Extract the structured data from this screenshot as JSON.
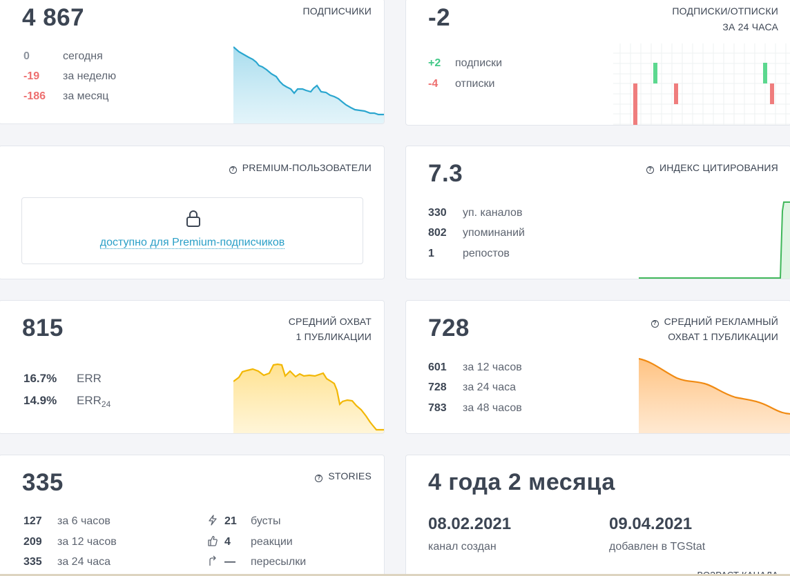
{
  "subscribers": {
    "value": "4 867",
    "label": "ПОДПИСЧИКИ",
    "stats": [
      {
        "value": "0",
        "text": "сегодня"
      },
      {
        "value": "-19",
        "text": "за неделю"
      },
      {
        "value": "-186",
        "text": "за месяц"
      }
    ],
    "color": "#2aa6cf"
  },
  "subs_unsubs": {
    "value": "-2",
    "label_line1": "ПОДПИСКИ/ОТПИСКИ",
    "label_line2": "ЗА 24 ЧАСА",
    "stats": [
      {
        "value": "+2",
        "text": "подписки"
      },
      {
        "value": "-4",
        "text": "отписки"
      }
    ]
  },
  "premium": {
    "label": "PREMIUM-ПОЛЬЗОВАТЕЛИ",
    "locked_text": "доступно для Premium-подписчиков",
    "icon": "lock-icon"
  },
  "citation": {
    "value": "7.3",
    "label": "ИНДЕКС ЦИТИРОВАНИЯ",
    "stats": [
      {
        "value": "330",
        "text": "уп. каналов"
      },
      {
        "value": "802",
        "text": "упоминаний"
      },
      {
        "value": "1",
        "text": "репостов"
      }
    ],
    "color": "#3fb75a"
  },
  "reach": {
    "value": "815",
    "label_line1": "СРЕДНИЙ ОХВАТ",
    "label_line2": "1 ПУБЛИКАЦИИ",
    "err": [
      {
        "value": "16.7%",
        "text": "ERR"
      },
      {
        "value": "14.9%",
        "text": "ERR",
        "sub": "24"
      }
    ],
    "color": "#f2b705"
  },
  "ad_reach": {
    "value": "728",
    "label_line1": "СРЕДНИЙ РЕКЛАМНЫЙ",
    "label_line2": "ОХВАТ 1 ПУБЛИКАЦИИ",
    "stats": [
      {
        "value": "601",
        "text": "за 12 часов"
      },
      {
        "value": "728",
        "text": "за 24 часа"
      },
      {
        "value": "783",
        "text": "за 48 часов"
      }
    ],
    "color": "#f08a12"
  },
  "stories": {
    "value": "335",
    "label": "STORIES",
    "stats": [
      {
        "value": "127",
        "text": "за 6 часов"
      },
      {
        "value": "209",
        "text": "за 12 часов"
      },
      {
        "value": "335",
        "text": "за 24 часа"
      }
    ],
    "side": [
      {
        "icon": "lightning-icon",
        "value": "21",
        "text": "бусты"
      },
      {
        "icon": "thumbs-up-icon",
        "value": "4",
        "text": "реакции"
      },
      {
        "icon": "forward-arrow-icon",
        "value": "—",
        "text": "пересылки"
      }
    ]
  },
  "age": {
    "value": "4 года 2 месяца",
    "created_date": "08.02.2021",
    "created_label": "канал создан",
    "added_date": "09.04.2021",
    "added_label": "добавлен в TGStat",
    "footer_label": "ВОЗРАСТ КАНАЛА"
  }
}
